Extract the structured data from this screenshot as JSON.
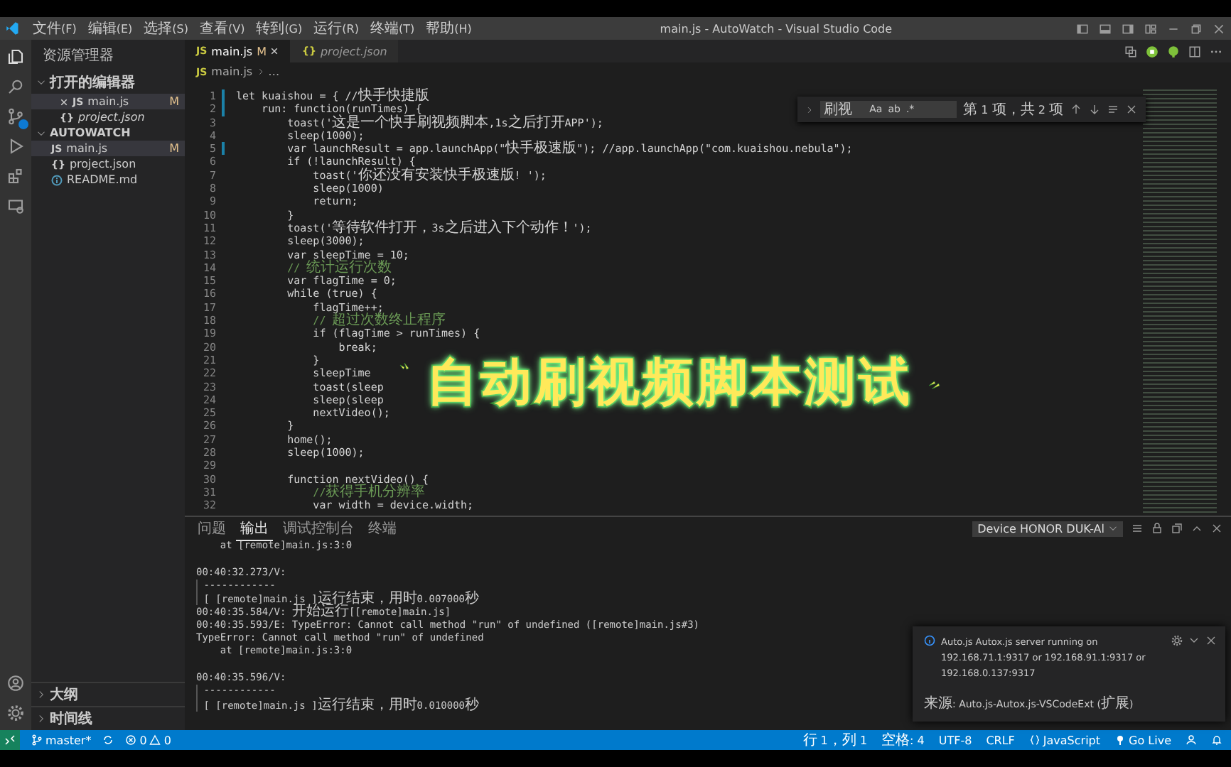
{
  "menu": [
    "文件(F)",
    "编辑(E)",
    "选择(S)",
    "查看(V)",
    "转到(G)",
    "运行(R)",
    "终端(T)",
    "帮助(H)"
  ],
  "window": {
    "title": "main.js - AutoWatch - Visual Studio Code"
  },
  "sidebar": {
    "title": "资源管理器",
    "sections": [
      {
        "title": "打开的编辑器",
        "expanded": true,
        "items": [
          {
            "name": "main.js",
            "kind": "js",
            "icon_label": "JS",
            "badge": "M",
            "selected": true,
            "preview": false
          },
          {
            "name": "project.json",
            "kind": "json",
            "icon_label": "{}",
            "selected": false,
            "preview": true
          }
        ]
      },
      {
        "title": "AUTOWATCH",
        "expanded": true,
        "items": [
          {
            "name": "main.js",
            "kind": "js",
            "icon_label": "JS",
            "badge": "M",
            "selected": true,
            "preview": false
          },
          {
            "name": "project.json",
            "kind": "json",
            "icon_label": "{}",
            "selected": false,
            "preview": false
          },
          {
            "name": "README.md",
            "kind": "md",
            "selected": false,
            "preview": false
          }
        ]
      }
    ],
    "footer": [
      {
        "title": "大纲",
        "expanded": false
      },
      {
        "title": "时间线",
        "expanded": false
      }
    ]
  },
  "tabs": [
    {
      "label": "main.js",
      "icon_label": "JS",
      "badge": "M",
      "selected": true
    },
    {
      "label": "project.json",
      "icon_label": "{}",
      "selected": false
    }
  ],
  "breadcrumb": {
    "file": "main.js",
    "icon_label": "JS",
    "rest": "…"
  },
  "find": {
    "value": "刷视",
    "result": "第 1 项，共 2 项",
    "options": [
      "Aa",
      "ab",
      ".*"
    ]
  },
  "code": [
    {
      "n": "1",
      "kind": "code",
      "modified": true,
      "text": "let kuaishou = { //快手快捷版"
    },
    {
      "n": "2",
      "kind": "code",
      "modified": true,
      "text": "    run: function(runTimes) {"
    },
    {
      "n": "3",
      "kind": "code",
      "modified": false,
      "text": "        toast('这是一个快手刷视频脚本,1s之后打开APP');"
    },
    {
      "n": "4",
      "kind": "code",
      "modified": false,
      "text": "        sleep(1000);"
    },
    {
      "n": "5",
      "kind": "code",
      "modified": true,
      "text": "        var launchResult = app.launchApp(\"快手极速版\"); //app.launchApp(\"com.kuaishou.nebula\");"
    },
    {
      "n": "6",
      "kind": "code",
      "modified": false,
      "text": "        if (!launchResult) {"
    },
    {
      "n": "7",
      "kind": "code",
      "modified": false,
      "text": "            toast('你还没有安装快手极速版! ');"
    },
    {
      "n": "8",
      "kind": "code",
      "modified": false,
      "text": "            sleep(1000)"
    },
    {
      "n": "9",
      "kind": "code",
      "modified": false,
      "text": "            return;"
    },
    {
      "n": "10",
      "kind": "code",
      "modified": false,
      "text": "        }"
    },
    {
      "n": "11",
      "kind": "code",
      "modified": false,
      "text": "        toast('等待软件打开，3s之后进入下个动作！');"
    },
    {
      "n": "12",
      "kind": "code",
      "modified": false,
      "text": "        sleep(3000);"
    },
    {
      "n": "13",
      "kind": "code",
      "modified": false,
      "text": "        var sleepTime = 10;"
    },
    {
      "n": "14",
      "kind": "comment",
      "modified": false,
      "text": "        // 统计运行次数"
    },
    {
      "n": "15",
      "kind": "code",
      "modified": false,
      "text": "        var flagTime = 0;"
    },
    {
      "n": "16",
      "kind": "code",
      "modified": false,
      "text": "        while (true) {"
    },
    {
      "n": "17",
      "kind": "code",
      "modified": false,
      "text": "            flagTime++;"
    },
    {
      "n": "18",
      "kind": "comment",
      "modified": false,
      "text": "            // 超过次数终止程序"
    },
    {
      "n": "19",
      "kind": "code",
      "modified": false,
      "text": "            if (flagTime > runTimes) {"
    },
    {
      "n": "20",
      "kind": "code",
      "modified": false,
      "text": "                break;"
    },
    {
      "n": "21",
      "kind": "code",
      "modified": false,
      "text": "            }"
    },
    {
      "n": "22",
      "kind": "code",
      "modified": false,
      "text": "            sleepTime"
    },
    {
      "n": "23",
      "kind": "code",
      "modified": false,
      "text": "            toast(sleep"
    },
    {
      "n": "24",
      "kind": "code",
      "modified": false,
      "text": "            sleep(sleep"
    },
    {
      "n": "25",
      "kind": "code",
      "modified": false,
      "text": "            nextVideo();"
    },
    {
      "n": "26",
      "kind": "code",
      "modified": false,
      "text": "        }"
    },
    {
      "n": "27",
      "kind": "code",
      "modified": false,
      "text": "        home();"
    },
    {
      "n": "28",
      "kind": "code",
      "modified": false,
      "text": "        sleep(1000);"
    },
    {
      "n": "29",
      "kind": "blank",
      "modified": false
    },
    {
      "n": "30",
      "kind": "code",
      "modified": false,
      "text": "        function nextVideo() {"
    },
    {
      "n": "31",
      "kind": "comment",
      "modified": false,
      "text": "            //获得手机分辨率"
    },
    {
      "n": "32",
      "kind": "code",
      "modified": false,
      "text": "            var width = device.width;"
    }
  ],
  "overlay": {
    "text": "自动刷视频脚本测试"
  },
  "panel": {
    "tabs": [
      {
        "label": "问题",
        "selected": false
      },
      {
        "label": "输出",
        "selected": true
      },
      {
        "label": "调试控制台",
        "selected": false
      },
      {
        "label": "终端",
        "selected": false
      }
    ],
    "device": "Device HONOR DUK-Al",
    "output": [
      {
        "kind": "text",
        "text": "    at [remote]main.js:3:0"
      },
      {
        "kind": "blank"
      },
      {
        "kind": "text",
        "text": "00:40:32.273/V:"
      },
      {
        "kind": "guide",
        "text": " ------------"
      },
      {
        "kind": "guide",
        "text": " [ [remote]main.js ]运行结束，用时0.007000秒"
      },
      {
        "kind": "text",
        "text": "00:40:35.584/V: 开始运行[[remote]main.js]"
      },
      {
        "kind": "text",
        "text": "00:40:35.593/E: TypeError: Cannot call method \"run\" of undefined ([remote]main.js#3)"
      },
      {
        "kind": "text",
        "text": "TypeError: Cannot call method \"run\" of undefined"
      },
      {
        "kind": "text",
        "text": "    at [remote]main.js:3:0"
      },
      {
        "kind": "blank"
      },
      {
        "kind": "text",
        "text": "00:40:35.596/V:"
      },
      {
        "kind": "guide",
        "text": " ------------"
      },
      {
        "kind": "guide",
        "text": " [ [remote]main.js ]运行结束，用时0.010000秒"
      }
    ]
  },
  "notification": {
    "message": "Auto.js Autox.js server running on 192.168.71.1:9317 or 192.168.91.1:9317 or 192.168.0.137:9317",
    "source": "来源: Auto.js-Autox.js-VSCodeExt (扩展)"
  },
  "status_bar": {
    "branch": "master*",
    "errors": "0",
    "warnings": "0",
    "items": [
      {
        "text": "行 1，列 1",
        "kind": "text"
      },
      {
        "text": "空格: 4",
        "kind": "text"
      },
      {
        "text": "UTF-8",
        "kind": "text"
      },
      {
        "text": "CRLF",
        "kind": "text"
      },
      {
        "text": "JavaScript",
        "kind": "language"
      },
      {
        "text": "Go Live",
        "kind": "live"
      }
    ]
  }
}
